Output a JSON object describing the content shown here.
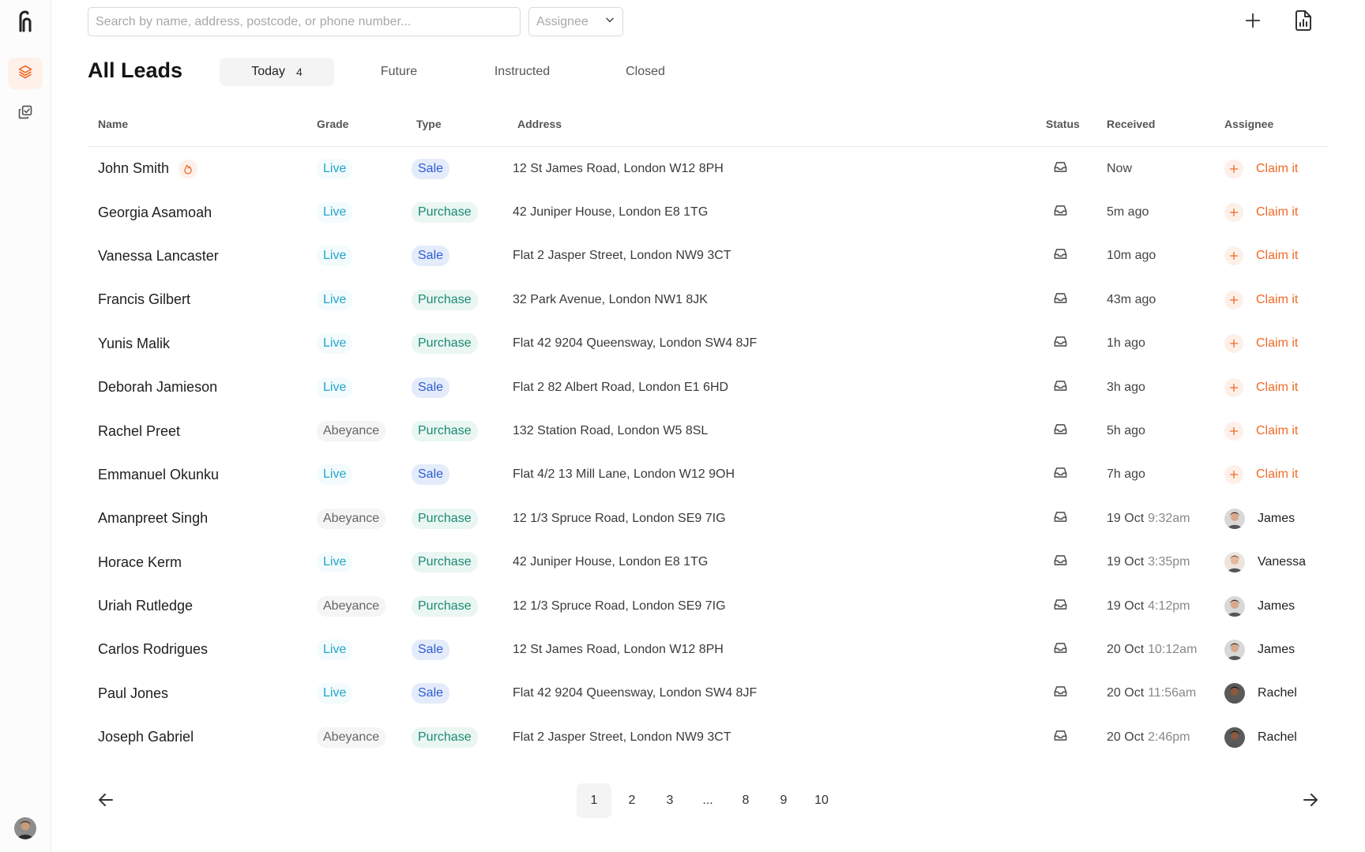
{
  "search": {
    "placeholder": "Search by name, address, postcode, or phone number..."
  },
  "assignee_filter": {
    "label": "Assignee"
  },
  "page_title": "All Leads",
  "tabs": [
    {
      "label": "Today",
      "count": "4"
    },
    {
      "label": "Future"
    },
    {
      "label": "Instructed"
    },
    {
      "label": "Closed"
    }
  ],
  "columns": {
    "name": "Name",
    "grade": "Grade",
    "type": "Type",
    "address": "Address",
    "status": "Status",
    "received": "Received",
    "assignee": "Assignee"
  },
  "claim_label": "Claim it",
  "rows": [
    {
      "name": "John Smith",
      "hot": true,
      "grade": "Live",
      "type": "Sale",
      "address": "12 St James Road, London W12 8PH",
      "received": "Now",
      "received_time": "",
      "assignee": ""
    },
    {
      "name": "Georgia Asamoah",
      "hot": false,
      "grade": "Live",
      "type": "Purchase",
      "address": "42 Juniper House, London E8 1TG",
      "received": "5m ago",
      "received_time": "",
      "assignee": ""
    },
    {
      "name": "Vanessa Lancaster",
      "hot": false,
      "grade": "Live",
      "type": "Sale",
      "address": "Flat 2 Jasper Street, London NW9 3CT",
      "received": "10m ago",
      "received_time": "",
      "assignee": ""
    },
    {
      "name": "Francis Gilbert",
      "hot": false,
      "grade": "Live",
      "type": "Purchase",
      "address": "32 Park Avenue, London NW1 8JK",
      "received": "43m ago",
      "received_time": "",
      "assignee": ""
    },
    {
      "name": "Yunis Malik",
      "hot": false,
      "grade": "Live",
      "type": "Purchase",
      "address": "Flat 42 9204 Queensway, London SW4 8JF",
      "received": "1h ago",
      "received_time": "",
      "assignee": ""
    },
    {
      "name": "Deborah Jamieson",
      "hot": false,
      "grade": "Live",
      "type": "Sale",
      "address": "Flat 2 82 Albert Road, London E1 6HD",
      "received": "3h ago",
      "received_time": "",
      "assignee": ""
    },
    {
      "name": "Rachel Preet",
      "hot": false,
      "grade": "Abeyance",
      "type": "Purchase",
      "address": "132 Station Road, London W5 8SL",
      "received": "5h ago",
      "received_time": "",
      "assignee": ""
    },
    {
      "name": "Emmanuel Okunku",
      "hot": false,
      "grade": "Live",
      "type": "Sale",
      "address": "Flat 4/2 13 Mill Lane, London W12 9OH",
      "received": "7h ago",
      "received_time": "",
      "assignee": ""
    },
    {
      "name": "Amanpreet Singh",
      "hot": false,
      "grade": "Abeyance",
      "type": "Purchase",
      "address": "12 1/3 Spruce Road, London SE9 7IG",
      "received": "19 Oct",
      "received_time": "9:32am",
      "assignee": "James"
    },
    {
      "name": "Horace Kerm",
      "hot": false,
      "grade": "Live",
      "type": "Purchase",
      "address": "42 Juniper House, London E8 1TG",
      "received": "19 Oct",
      "received_time": "3:35pm",
      "assignee": "Vanessa"
    },
    {
      "name": "Uriah Rutledge",
      "hot": false,
      "grade": "Abeyance",
      "type": "Purchase",
      "address": "12 1/3 Spruce Road, London SE9 7IG",
      "received": "19 Oct",
      "received_time": "4:12pm",
      "assignee": "James"
    },
    {
      "name": "Carlos Rodrigues",
      "hot": false,
      "grade": "Live",
      "type": "Sale",
      "address": "12 St James Road, London W12 8PH",
      "received": "20 Oct",
      "received_time": "10:12am",
      "assignee": "James"
    },
    {
      "name": "Paul Jones",
      "hot": false,
      "grade": "Live",
      "type": "Sale",
      "address": "Flat 42 9204 Queensway, London SW4 8JF",
      "received": "20 Oct",
      "received_time": "11:56am",
      "assignee": "Rachel"
    },
    {
      "name": "Joseph Gabriel",
      "hot": false,
      "grade": "Abeyance",
      "type": "Purchase",
      "address": "Flat 2 Jasper Street, London NW9 3CT",
      "received": "20 Oct",
      "received_time": "2:46pm",
      "assignee": "Rachel"
    }
  ],
  "pagination": {
    "pages": [
      "1",
      "2",
      "3",
      "...",
      "8",
      "9",
      "10"
    ],
    "current": "1"
  },
  "colors": {
    "accent": "#ef6a27",
    "live": "#22a6c9",
    "sale": "#2f5bd3",
    "purchase": "#1b8a73"
  },
  "icons": {
    "logo": "brand-logo-icon",
    "leads": "layers-icon",
    "copy": "copy-check-icon",
    "add": "plus-icon",
    "report": "file-chart-icon",
    "status": "inbox-icon",
    "hot": "fire-icon",
    "prev": "arrow-left-icon",
    "next": "arrow-right-icon"
  }
}
